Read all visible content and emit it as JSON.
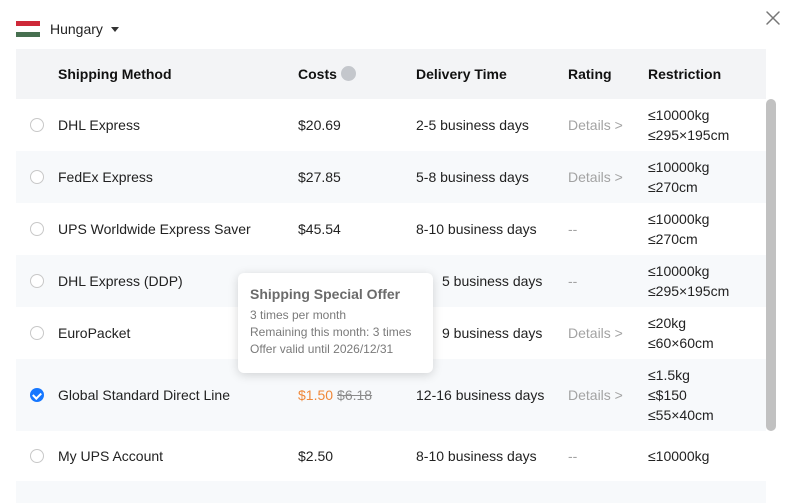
{
  "country": {
    "name": "Hungary",
    "flag_colors": [
      "#ce2939",
      "#ffffff",
      "#477050"
    ]
  },
  "header": {
    "method": "Shipping Method",
    "costs": "Costs",
    "delivery": "Delivery Time",
    "rating": "Rating",
    "restriction": "Restriction"
  },
  "rows": [
    {
      "method": "DHL Express",
      "cost": "$20.69",
      "delivery": "2-5 business days",
      "rating": "Details >",
      "restriction": [
        "≤10000kg",
        "≤295×195cm"
      ],
      "selected": false
    },
    {
      "method": "FedEx Express",
      "cost": "$27.85",
      "delivery": "5-8 business days",
      "rating": "Details >",
      "restriction": [
        "≤10000kg",
        "≤270cm"
      ],
      "selected": false
    },
    {
      "method": "UPS Worldwide Express Saver",
      "cost": "$45.54",
      "delivery": "8-10 business days",
      "rating": "--",
      "restriction": [
        "≤10000kg",
        "≤270cm"
      ],
      "selected": false
    },
    {
      "method": "DHL Express (DDP)",
      "cost": "",
      "delivery": "5 business days",
      "rating": "--",
      "restriction": [
        "≤10000kg",
        "≤295×195cm"
      ],
      "selected": false
    },
    {
      "method": "EuroPacket",
      "cost": "",
      "delivery": "9 business days",
      "rating": "Details >",
      "restriction": [
        "≤20kg",
        "≤60×60cm"
      ],
      "selected": false
    },
    {
      "method": "Global Standard Direct Line",
      "cost": "$1.50",
      "cost_original": "$6.18",
      "delivery": "12-16 business days",
      "rating": "Details >",
      "restriction": [
        "≤1.5kg",
        "≤$150",
        "≤55×40cm"
      ],
      "selected": true
    },
    {
      "method": "My UPS Account",
      "cost": "$2.50",
      "delivery": "8-10 business days",
      "rating": "--",
      "restriction": [
        "≤10000kg"
      ],
      "selected": false
    }
  ],
  "tooltip": {
    "title": "Shipping Special Offer",
    "lines": [
      "3 times per month",
      "Remaining this month: 3 times",
      "Offer valid until 2026/12/31"
    ]
  },
  "colors": {
    "accent": "#1677ff",
    "special_price": "#f0883a",
    "header_bg": "#f3f4f6"
  }
}
